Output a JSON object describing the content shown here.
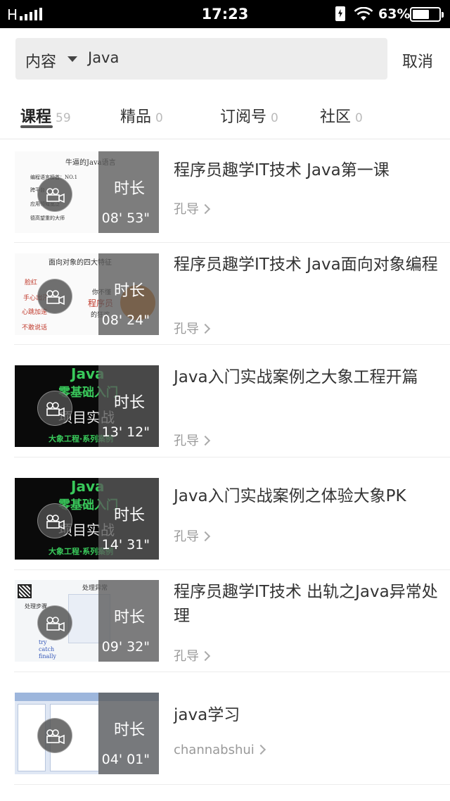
{
  "status_bar": {
    "carrier": "H",
    "time": "17:23",
    "battery_pct": "63%",
    "battery_level": 0.63
  },
  "search": {
    "scope": "内容",
    "query": "Java",
    "cancel_label": "取消"
  },
  "tabs": [
    {
      "label": "课程",
      "count": "59",
      "active": true
    },
    {
      "label": "精品",
      "count": "0",
      "active": false
    },
    {
      "label": "订阅号",
      "count": "0",
      "active": false
    },
    {
      "label": "社区",
      "count": "0",
      "active": false
    }
  ],
  "results": [
    {
      "title": "程序员趣学IT技术 Java第一课",
      "author": "孔导",
      "duration_label": "时长",
      "duration": "08' 53\"",
      "thumb_text": [
        "牛逼的Java语言",
        "编程语言榜首：NO.1",
        "跨平台",
        "应用领域宽泛",
        "德高望重的大师"
      ]
    },
    {
      "title": "程序员趣学IT技术 Java面向对象编程",
      "author": "孔导",
      "duration_label": "时长",
      "duration": "08' 24\"",
      "thumb_text": [
        "面向对象的四大特征",
        "脸红",
        "手心出汗",
        "心跳加速",
        "不敢说话",
        "你不懂",
        "程序员",
        "的狂欢"
      ]
    },
    {
      "title": "Java入门实战案例之大象工程开篇",
      "author": "孔导",
      "duration_label": "时长",
      "duration": "13' 12\"",
      "thumb_text": [
        "Java",
        "零基础入门",
        "项目实战",
        "大象工程·系列案例"
      ]
    },
    {
      "title": "Java入门实战案例之体验大象PK",
      "author": "孔导",
      "duration_label": "时长",
      "duration": "14' 31\"",
      "thumb_text": [
        "Java",
        "零基础入门",
        "项目实战",
        "大象工程·系列案例"
      ]
    },
    {
      "title": "程序员趣学IT技术 出轨之Java异常处理",
      "author": "孔导",
      "duration_label": "时长",
      "duration": "09' 32\"",
      "thumb_text": [
        "处理异常",
        "处理步骤",
        "try",
        "catch",
        "finally"
      ]
    },
    {
      "title": "java学习",
      "author": "channabshui",
      "duration_label": "时长",
      "duration": "04' 01\""
    }
  ],
  "colors": {
    "status_bg": "#000000",
    "search_bg": "#ededed",
    "title_text": "#333333",
    "meta_text": "#999999",
    "overlay": "#5a5a5a"
  },
  "icons": [
    "signal-icon",
    "charging-icon",
    "wifi-icon",
    "battery-icon",
    "caret-down-icon",
    "camera-icon",
    "chevron-right-icon"
  ]
}
